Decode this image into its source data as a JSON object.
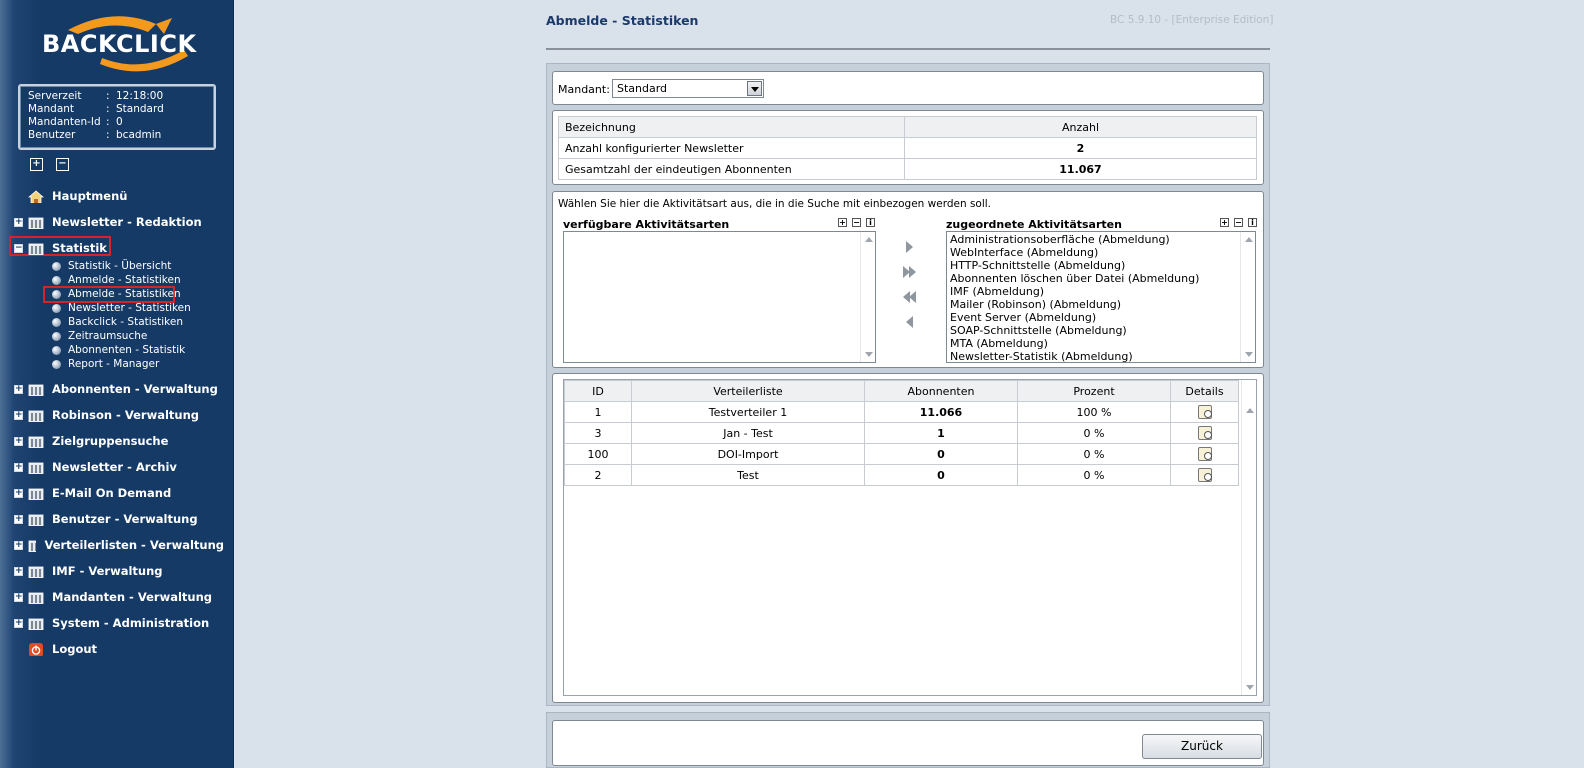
{
  "app": {
    "logo_text": "BACKCLICK",
    "version": "BC 5.9.10 - [Enterprise Edition]"
  },
  "info": {
    "rows": [
      {
        "key": "Serverzeit",
        "sep": ":",
        "value": "12:18:00"
      },
      {
        "key": "Mandant",
        "sep": ":",
        "value": "Standard"
      },
      {
        "key": "Mandanten-Id",
        "sep": ":",
        "value": "0"
      },
      {
        "key": "Benutzer",
        "sep": ":",
        "value": "bcadmin"
      }
    ]
  },
  "tree_controls": {
    "expand": "+",
    "collapse": "−"
  },
  "nav": {
    "home": "Hauptmenü",
    "items": [
      "Newsletter - Redaktion",
      "Statistik",
      "Abonnenten - Verwaltung",
      "Robinson - Verwaltung",
      "Zielgruppensuche",
      "Newsletter - Archiv",
      "E-Mail On Demand",
      "Benutzer - Verwaltung",
      "Verteilerlisten - Verwaltung",
      "IMF - Verwaltung",
      "Mandanten - Verwaltung",
      "System - Administration"
    ],
    "statistik_sub": [
      "Statistik - Übersicht",
      "Anmelde - Statistiken",
      "Abmelde - Statistiken",
      "Newsletter - Statistiken",
      "Backclick - Statistiken",
      "Zeitraumsuche",
      "Abonnenten - Statistik",
      "Report - Manager"
    ],
    "logout": "Logout",
    "active_section": "Statistik",
    "active_item": "Abmelde - Statistiken"
  },
  "page": {
    "title": "Abmelde - Statistiken"
  },
  "mandant": {
    "label": "Mandant:",
    "value": "Standard"
  },
  "summary": {
    "headers": [
      "Bezeichnung",
      "Anzahl"
    ],
    "rows": [
      [
        "Anzahl konfigurierter Newsletter",
        "2"
      ],
      [
        "Gesamtzahl der eindeutigen Abonnenten",
        "11.067"
      ]
    ]
  },
  "activity": {
    "instruction": "Wählen Sie hier die Aktivitätsart aus, die in die Suche mit einbezogen werden soll.",
    "available_label": "verfügbare Aktivitätsarten",
    "assigned_label": "zugeordnete Aktivitätsarten",
    "available": [],
    "assigned": [
      "Administrationsoberfläche (Abmeldung)",
      "WebInterface (Abmeldung)",
      "HTTP-Schnittstelle (Abmeldung)",
      "Abonnenten löschen über Datei (Abmeldung)",
      "IMF (Abmeldung)",
      "Mailer (Robinson) (Abmeldung)",
      "Event Server (Abmeldung)",
      "SOAP-Schnittstelle (Abmeldung)",
      "MTA (Abmeldung)",
      "Newsletter-Statistik (Abmeldung)"
    ],
    "mini_buttons": [
      "+",
      "−",
      "i"
    ]
  },
  "lists": {
    "headers": [
      "ID",
      "Verteilerliste",
      "Abonnenten",
      "Prozent",
      "Details"
    ],
    "rows": [
      [
        "1",
        "Testverteiler 1",
        "11.066",
        "100 %"
      ],
      [
        "3",
        "Jan - Test",
        "1",
        "0 %"
      ],
      [
        "100",
        "DOI-Import",
        "0",
        "0 %"
      ],
      [
        "2",
        "Test",
        "0",
        "0 %"
      ]
    ]
  },
  "buttons": {
    "back": "Zurück"
  },
  "colors": {
    "sidebar": "#163a66",
    "highlight": "#d2242b",
    "title": "#1b3a6b"
  }
}
